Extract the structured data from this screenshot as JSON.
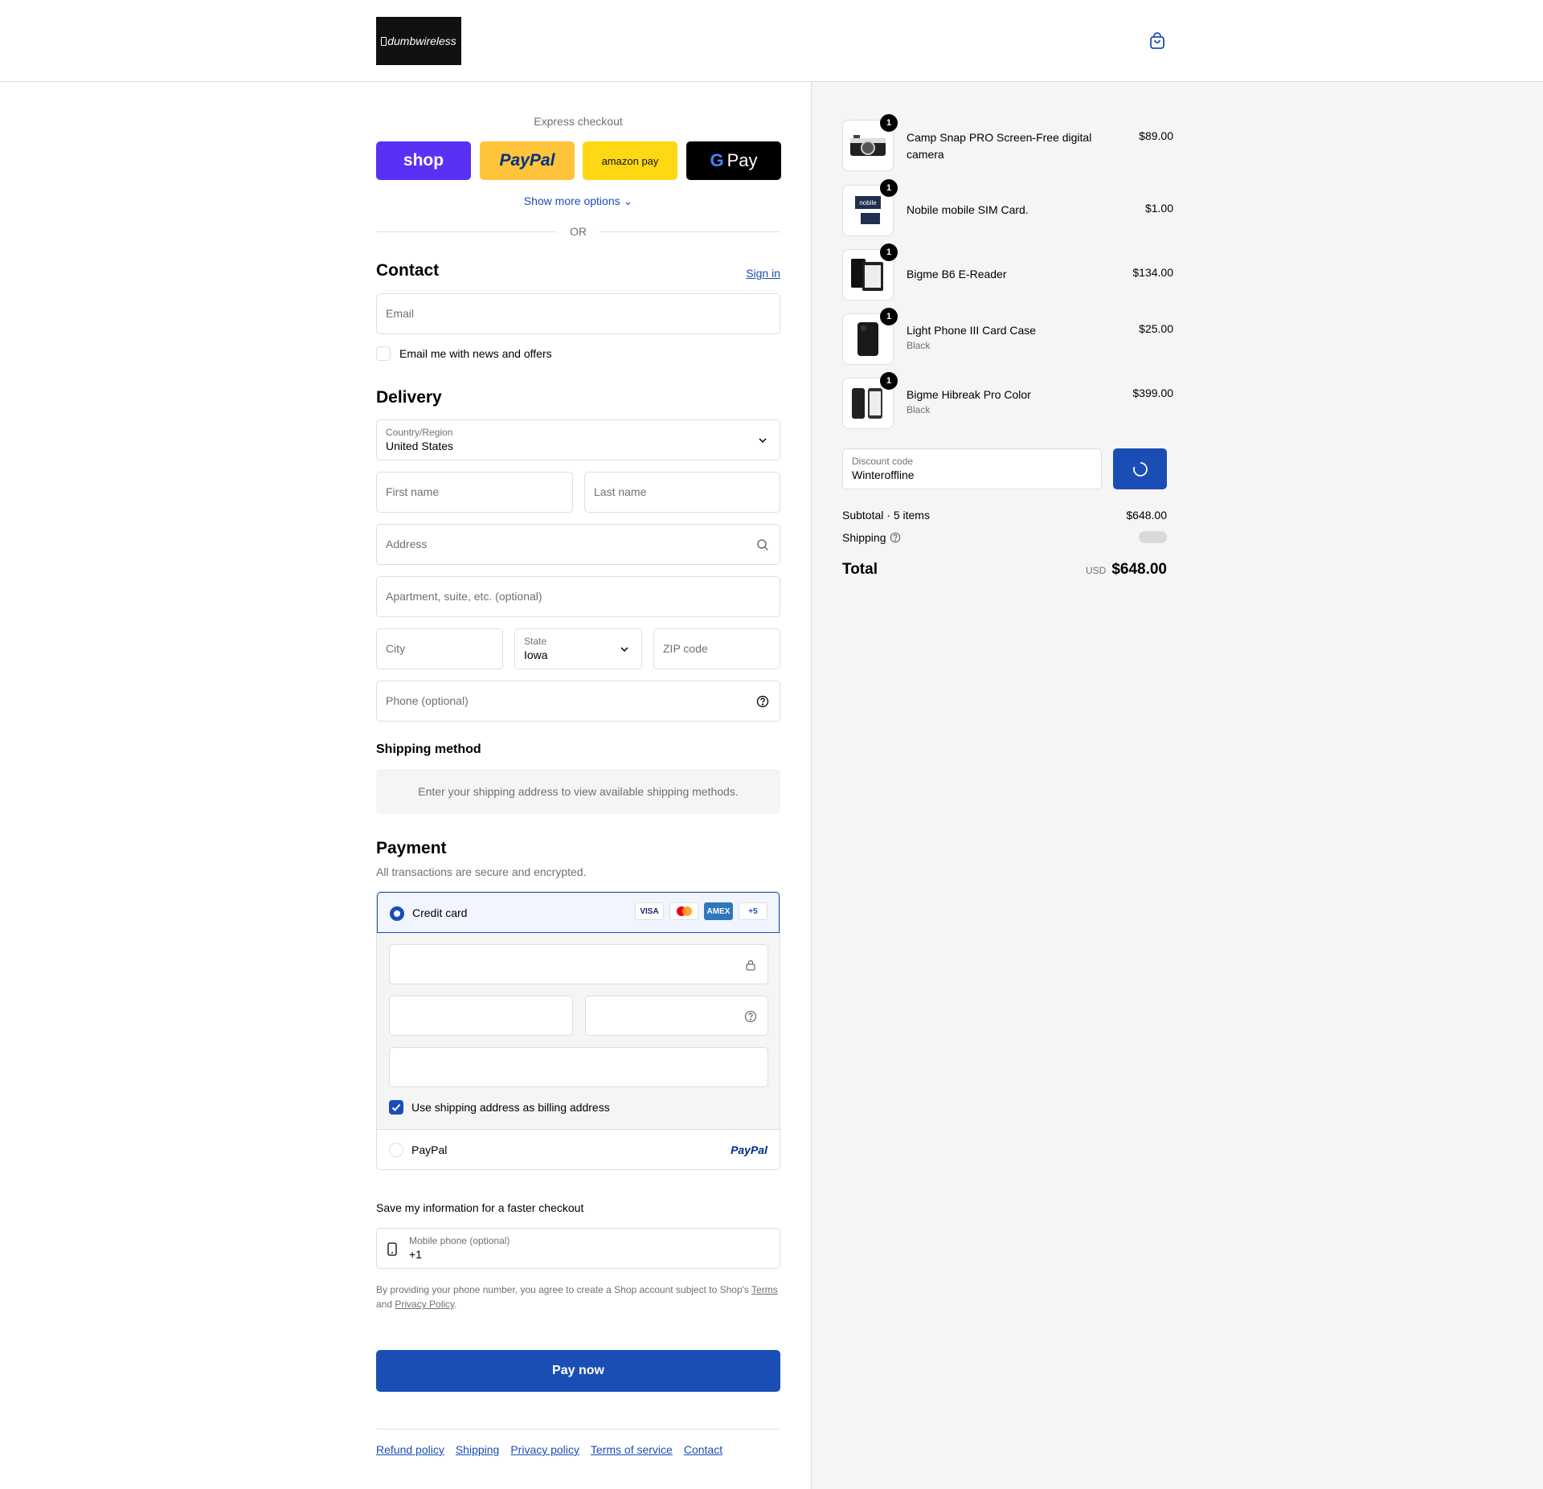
{
  "header": {
    "logo_text": "dumbwireless",
    "cart_icon": "shopping-bag-icon"
  },
  "express": {
    "title": "Express checkout",
    "shop_label": "shop",
    "paypal_label": "PayPal",
    "amazon_label": "amazon pay",
    "gpay_label": "Pay",
    "show_more": "Show more options",
    "or": "OR",
    "colors": {
      "shop": "#5a31f4",
      "paypal": "#ffc439",
      "amazon": "#ffd814",
      "gpay": "#000000"
    }
  },
  "contact": {
    "title": "Contact",
    "sign_in": "Sign in",
    "email_placeholder": "Email",
    "news_label": "Email me with news and offers"
  },
  "delivery": {
    "title": "Delivery",
    "country_label": "Country/Region",
    "country_value": "United States",
    "first_name": "First name",
    "last_name": "Last name",
    "address": "Address",
    "apartment": "Apartment, suite, etc. (optional)",
    "city": "City",
    "state_label": "State",
    "state_value": "Iowa",
    "zip": "ZIP code",
    "phone": "Phone (optional)"
  },
  "shipping_method": {
    "title": "Shipping method",
    "message": "Enter your shipping address to view available shipping methods."
  },
  "payment": {
    "title": "Payment",
    "subtitle": "All transactions are secure and encrypted.",
    "credit_card": "Credit card",
    "brands": [
      "VISA",
      "",
      "AMEX",
      "+5"
    ],
    "billing_label": "Use shipping address as billing address",
    "paypal": "PayPal",
    "paypal_logo": "PayPal"
  },
  "save": {
    "title": "Save my information for a faster checkout",
    "mobile_label": "Mobile phone (optional)",
    "mobile_value": "+1",
    "disclaimer_1": "By providing your phone number, you agree to create a Shop account subject to Shop's",
    "terms": "Terms",
    "and": "and",
    "privacy": "Privacy Policy",
    "period": "."
  },
  "pay_now": "Pay now",
  "footer": [
    "Refund policy",
    "Shipping",
    "Privacy policy",
    "Terms of service",
    "Contact"
  ],
  "cart": {
    "items": [
      {
        "name": "Camp Snap PRO Screen-Free digital camera",
        "variant": "",
        "price": "$89.00",
        "qty": "1"
      },
      {
        "name": "Nobile mobile SIM Card.",
        "variant": "",
        "price": "$1.00",
        "qty": "1"
      },
      {
        "name": "Bigme B6 E-Reader",
        "variant": "",
        "price": "$134.00",
        "qty": "1"
      },
      {
        "name": "Light Phone III Card Case",
        "variant": "Black",
        "price": "$25.00",
        "qty": "1"
      },
      {
        "name": "Bigme Hibreak Pro Color",
        "variant": "Black",
        "price": "$399.00",
        "qty": "1"
      }
    ],
    "discount_label": "Discount code",
    "discount_value": "Winteroffline",
    "subtotal_label": "Subtotal · 5 items",
    "subtotal_value": "$648.00",
    "shipping_label": "Shipping",
    "total_label": "Total",
    "currency": "USD",
    "total_value": "$648.00"
  },
  "accent": "#1b4eb5"
}
